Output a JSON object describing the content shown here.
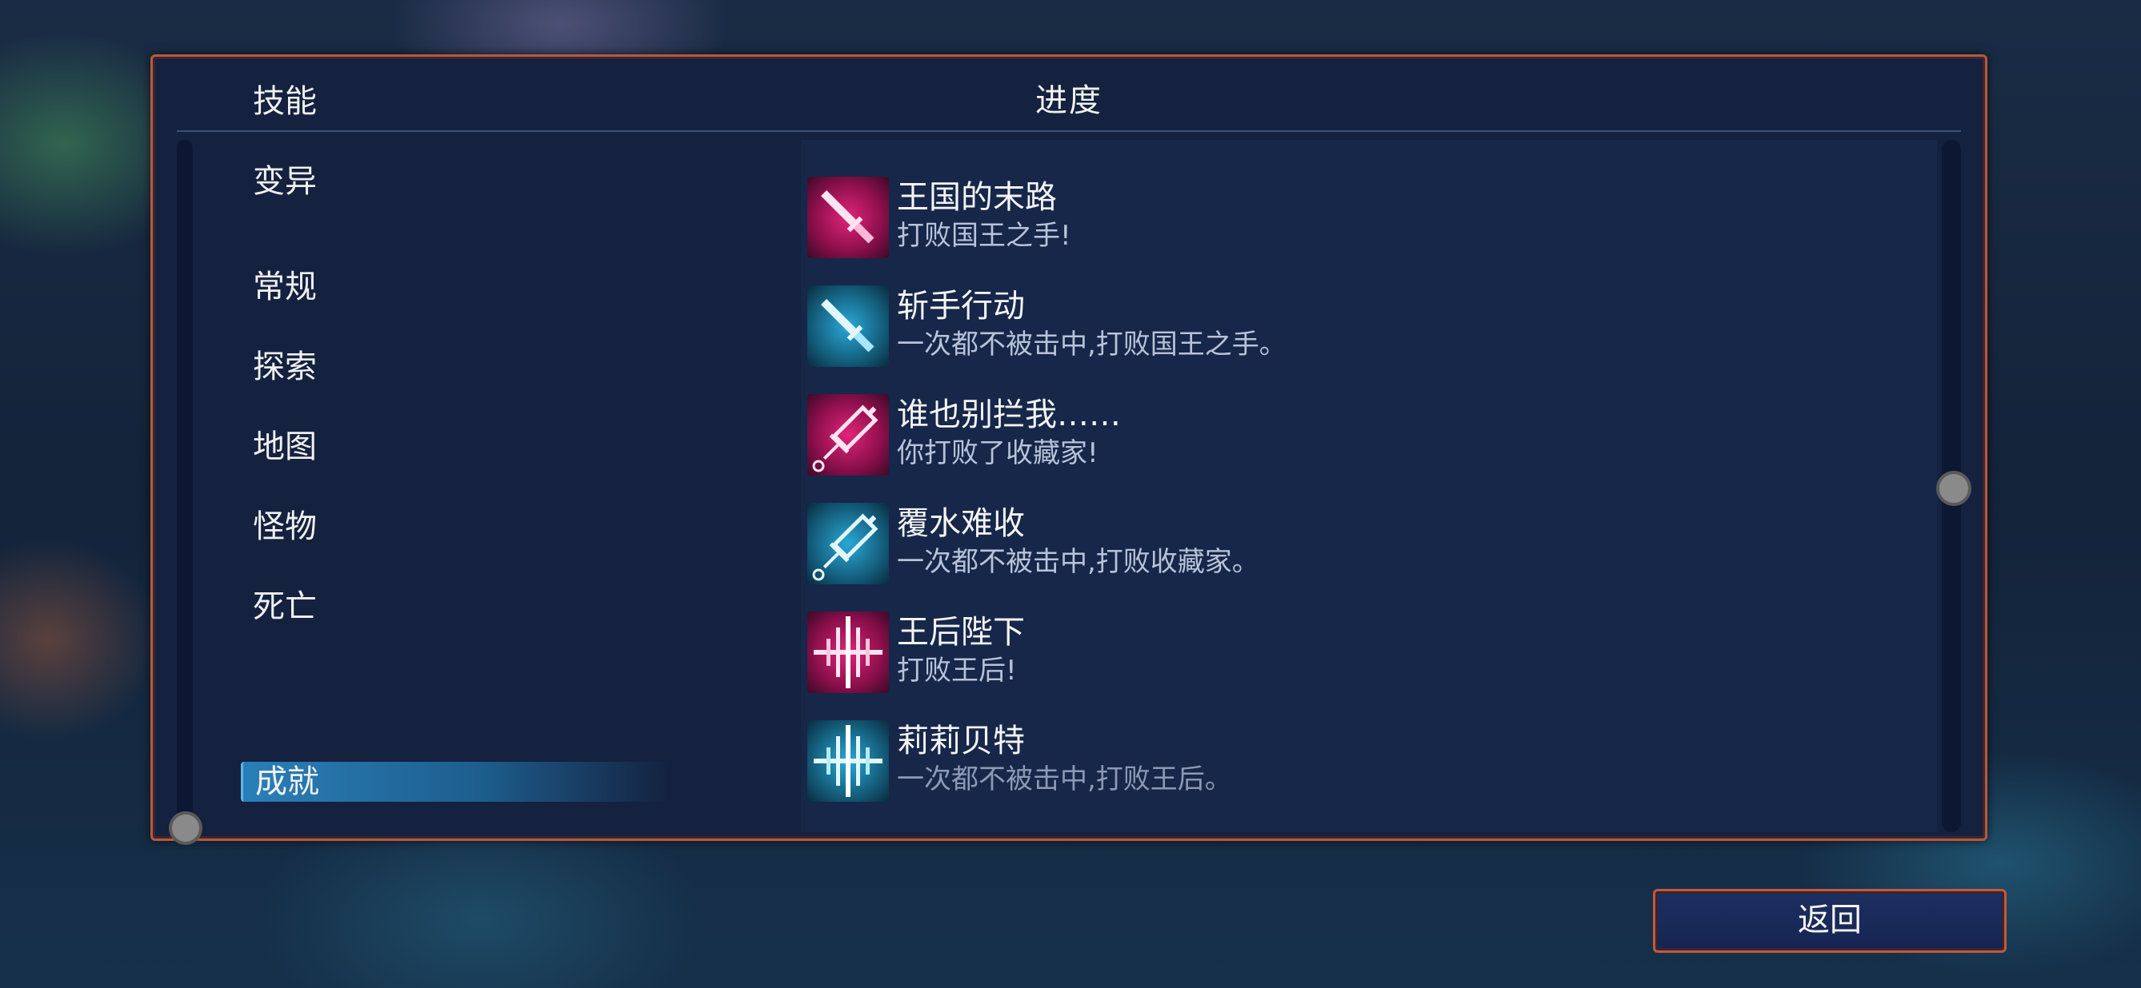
{
  "panel": {
    "title": "进度"
  },
  "nav": {
    "items": [
      {
        "label": "技能"
      },
      {
        "label": "变异"
      },
      {
        "label": "常规"
      },
      {
        "label": "探索"
      },
      {
        "label": "地图"
      },
      {
        "label": "怪物"
      },
      {
        "label": "死亡"
      },
      {
        "label": "成就",
        "selected": true
      }
    ]
  },
  "achievements": [
    {
      "title": "王国的末路",
      "desc": "打败国王之手!",
      "icon": "sword-icon",
      "color": "#e0247a"
    },
    {
      "title": "斩手行动",
      "desc": "一次都不被击中,打败国王之手。",
      "icon": "sword-icon",
      "color": "#2aa8d8"
    },
    {
      "title": "谁也别拦我……",
      "desc": "你打败了收藏家!",
      "icon": "syringe-icon",
      "color": "#e0247a"
    },
    {
      "title": "覆水难收",
      "desc": "一次都不被击中,打败收藏家。",
      "icon": "syringe-icon",
      "color": "#2aa8d8"
    },
    {
      "title": "王后陛下",
      "desc": "打败王后!",
      "icon": "soundwave-icon",
      "color": "#e0247a"
    },
    {
      "title": "莉莉贝特",
      "desc": "一次都不被击中,打败王后。",
      "icon": "soundwave-icon",
      "color": "#2aa8d8"
    }
  ],
  "footer": {
    "back_label": "返回"
  },
  "colors": {
    "panel_border": "#b65a3a",
    "selection": "#2a7fb8",
    "magenta": "#e0247a",
    "cyan": "#2aa8d8"
  }
}
